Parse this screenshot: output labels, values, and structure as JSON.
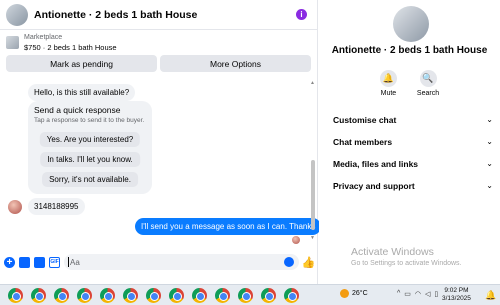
{
  "header": {
    "title": "Antionette · 2 beds 1 bath House",
    "info_icon": "info-icon",
    "info_color": "#8a2be2"
  },
  "listing": {
    "source": "Marketplace",
    "price_line": "$750 · 2 beds 1 bath House"
  },
  "actions": {
    "pending": "Mark as pending",
    "more": "More Options"
  },
  "messages": {
    "question": "Hello, is this still available?",
    "quick_title": "Send a quick response",
    "quick_sub": "Tap a response to send it to the buyer.",
    "quick_replies": [
      "Yes. Are you interested?",
      "In talks. I'll let you know.",
      "Sorry, it's not available."
    ],
    "buyer_msg": "3148188995",
    "seller_msg": "I'll send you a message as soon as I can. Thanks"
  },
  "composer": {
    "placeholder": "Aa"
  },
  "sidebar": {
    "name": "Antionette · 2 beds 1 bath House",
    "mute": "Mute",
    "search": "Search",
    "sections": [
      "Customise chat",
      "Chat members",
      "Media, files and links",
      "Privacy and support"
    ]
  },
  "watermark": {
    "line1": "Activate Windows",
    "line2": "Go to Settings to activate Windows."
  },
  "taskbar": {
    "temp": "26°C",
    "time": "9:02 PM",
    "date": "3/13/2025",
    "accent": "#0866ff"
  }
}
